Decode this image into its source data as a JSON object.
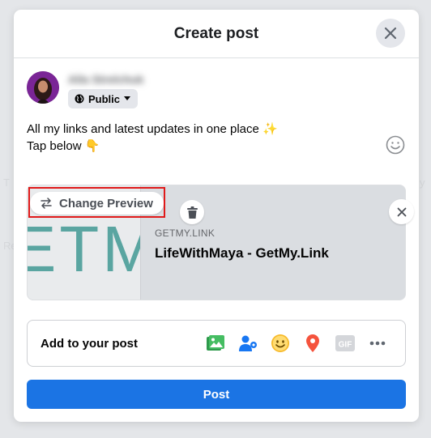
{
  "modal": {
    "title": "Create post"
  },
  "user": {
    "name": "Alla Strelchuk",
    "audience_label": "Public"
  },
  "composer": {
    "line1": "All my links and latest updates in one place ✨",
    "line2": "Tap below 👇"
  },
  "link_preview": {
    "change_preview_label": "Change Preview",
    "domain": "GETMY.LINK",
    "title": "LifeWithMaya - GetMy.Link",
    "image_text": "ETM"
  },
  "add_to_post": {
    "label": "Add to your post",
    "icons": [
      "photo-video-icon",
      "tag-people-icon",
      "feeling-activity-icon",
      "check-in-icon",
      "gif-icon",
      "more-icon"
    ],
    "gif_text": "GIF"
  },
  "post_button": {
    "label": "Post"
  },
  "colors": {
    "primary": "#1b74e4",
    "highlight": "#e01a1a",
    "photo_green": "#45bd62",
    "tag_blue": "#1877f2",
    "feeling_yellow": "#f7b928",
    "checkin_red": "#f5533d",
    "teal_text": "#5aa5a1"
  }
}
